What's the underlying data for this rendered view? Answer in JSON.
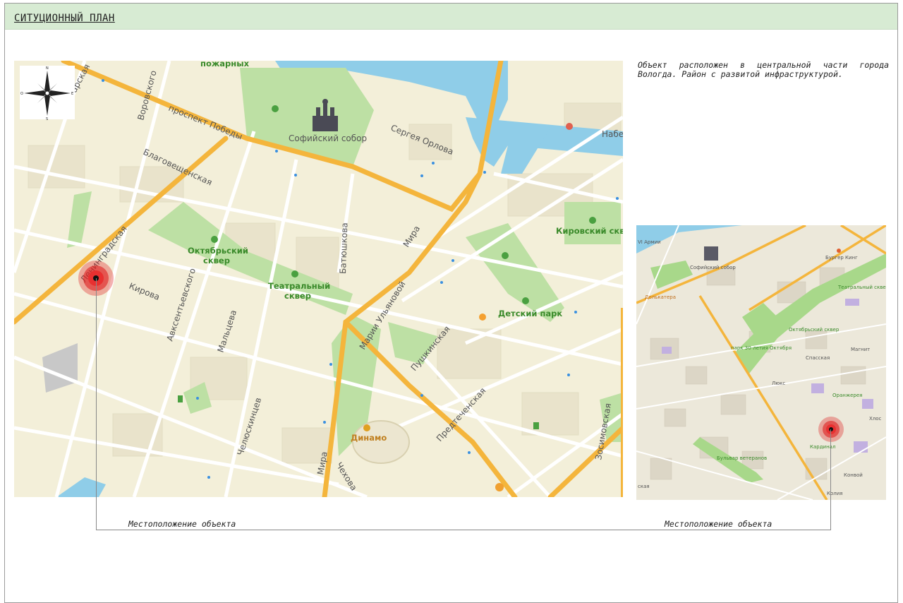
{
  "sheet": {
    "title": "СИТУЦИОННЫЙ ПЛАН"
  },
  "description": "Объект расположен в центральной части города Вологда. Район с развитой инфраструктурой.",
  "captions": {
    "left": "Местоположение объекта",
    "right": "Местоположение объекта"
  },
  "compass": {
    "n": "N",
    "s": "S",
    "e": "E",
    "w": "O"
  },
  "main_map": {
    "labels": {
      "pozharnyh": "пожарных",
      "voroshilov": "Воровского",
      "tarskaya": "тарская",
      "pobedy": "проспект Победы",
      "blagov": "Благовещенская",
      "sofia": "Софийский собор",
      "orlova": "Сергея Орлова",
      "naber": "Набер",
      "leningrad": "Ленинградская",
      "oktyabr1": "Октябрьский",
      "oktyabr2": "сквер",
      "teatr1": "Театральный",
      "teatr2": "сквер",
      "batyushkova": "Батюшкова",
      "mira": "Мира",
      "mira2": "Мира",
      "kirova": "Кирова",
      "avksentievskogo": "Авксентьевского",
      "maltseva": "Мальцева",
      "chelyuskintsev": "Челюскинцев",
      "ulyanovoy": "Марии Ульяновой",
      "pushkinskaya": "Пушкинская",
      "detskiy": "Детский парк",
      "kirovskiy": "Кировский сквер",
      "predtech": "Предтеченская",
      "zosimovskaya": "Зосимовская",
      "dinamo": "Динамо",
      "chekhova": "Чехова"
    }
  },
  "mini_map": {
    "labels": {
      "armii": "VI Армии",
      "sofia": "Софийский собор",
      "burger": "Бургер Кинг",
      "dolkatera": "Долькатера",
      "teatr": "Театральный сквер",
      "oktyabr": "Октябрьский сквер",
      "park30": "парк 30-летия Октября",
      "spasskaya": "Спасская",
      "magnit": "Магнит",
      "lux": "Люкс",
      "oranzh": "Оранжерея",
      "bulvar": "Бульвар ветеранов",
      "kardinal": "Кардинал",
      "konvoy": "Конвой",
      "kolia": "Колия",
      "khlos": "Хлос",
      "kaya": "ская"
    }
  },
  "colors": {
    "map_bg": "#f3efd9",
    "road_major": "#f4b53c",
    "road_minor": "#ffffff",
    "water": "#8fcde8",
    "park": "#bde0a4",
    "marker": "#e02020",
    "title_band": "#d7ebd3"
  }
}
